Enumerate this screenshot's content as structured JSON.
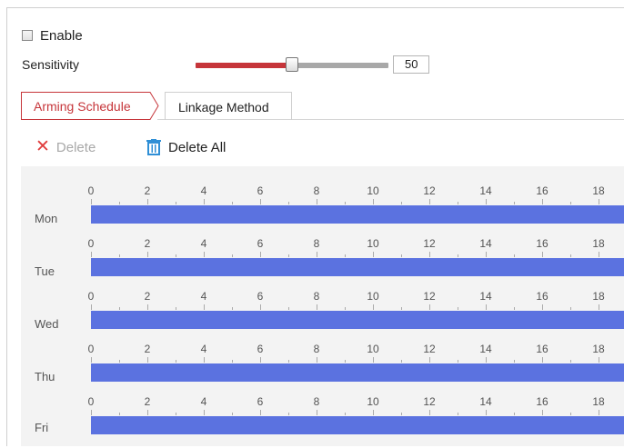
{
  "enable": {
    "label": "Enable",
    "checked": false
  },
  "sensitivity": {
    "label": "Sensitivity",
    "value": "50",
    "level_percent": 50
  },
  "tabs": [
    {
      "label": "Arming Schedule",
      "active": true
    },
    {
      "label": "Linkage Method",
      "active": false
    }
  ],
  "toolbar": {
    "delete_label": "Delete",
    "delete_all_label": "Delete All"
  },
  "schedule": {
    "hour_ticks": [
      "0",
      "2",
      "4",
      "6",
      "8",
      "10",
      "12",
      "14",
      "16",
      "18"
    ],
    "days": [
      {
        "label": "Mon"
      },
      {
        "label": "Tue"
      },
      {
        "label": "Wed"
      },
      {
        "label": "Thu"
      },
      {
        "label": "Fri"
      }
    ]
  },
  "colors": {
    "accent": "#c6353a",
    "schedule_bar": "#5b72e0",
    "delete_icon": "#e03c3c",
    "trash_icon": "#2f8fd6"
  }
}
